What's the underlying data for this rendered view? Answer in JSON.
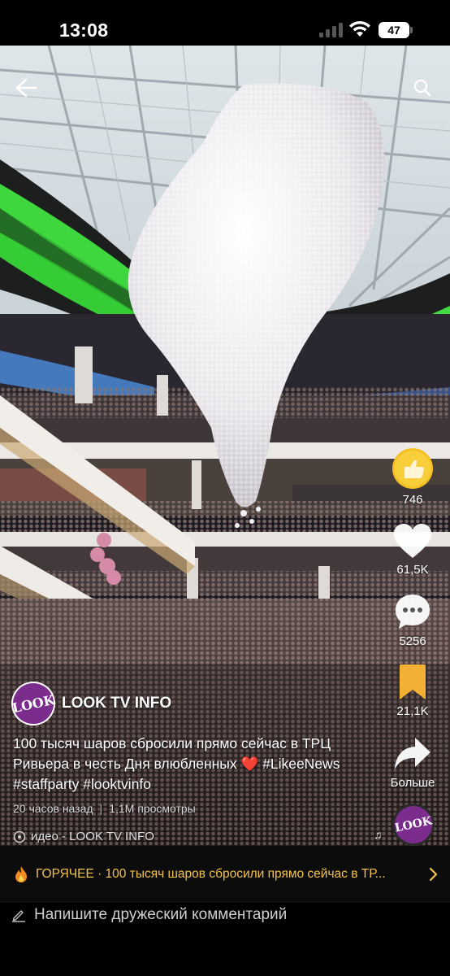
{
  "status_bar": {
    "time": "13:08",
    "battery": "47"
  },
  "video": {
    "back_icon": "arrow-left-icon",
    "search_icon": "search-icon",
    "rail": {
      "super_like": {
        "icon": "thumbs-up-badge-icon",
        "count": "746"
      },
      "like": {
        "icon": "heart-icon",
        "count": "61,5K"
      },
      "comments": {
        "icon": "chat-bubble-icon",
        "count": "5256"
      },
      "save": {
        "icon": "bookmark-icon",
        "count": "21,1K"
      },
      "share": {
        "icon": "share-arrow-icon",
        "label": "Больше"
      }
    },
    "author": {
      "avatar_text": "LOOK",
      "name": "LOOK TV INFO"
    },
    "caption": "100 тысяч шаров сбросили прямо сейчас в ТРЦ Ривьера в честь Дня влюбленных ❤️ #LikeeNews #staffparty #looktvinfo",
    "meta": {
      "time_ago": "20 часов назад",
      "separator": "|",
      "views": "1,1М просмотры"
    },
    "music": {
      "text": "идео - LOOK TV INFO",
      "disc_text": "LOOK"
    }
  },
  "hot_bar": {
    "text": "ГОРЯЧЕЕ · 100 тысяч шаров сбросили прямо сейчас в ТР..."
  },
  "comment_bar": {
    "placeholder": "Напишите дружеский комментарий"
  },
  "colors": {
    "accent_gold": "#f5c24a",
    "avatar_purple": "#7b2d8e",
    "bookmark": "#f2b134"
  }
}
